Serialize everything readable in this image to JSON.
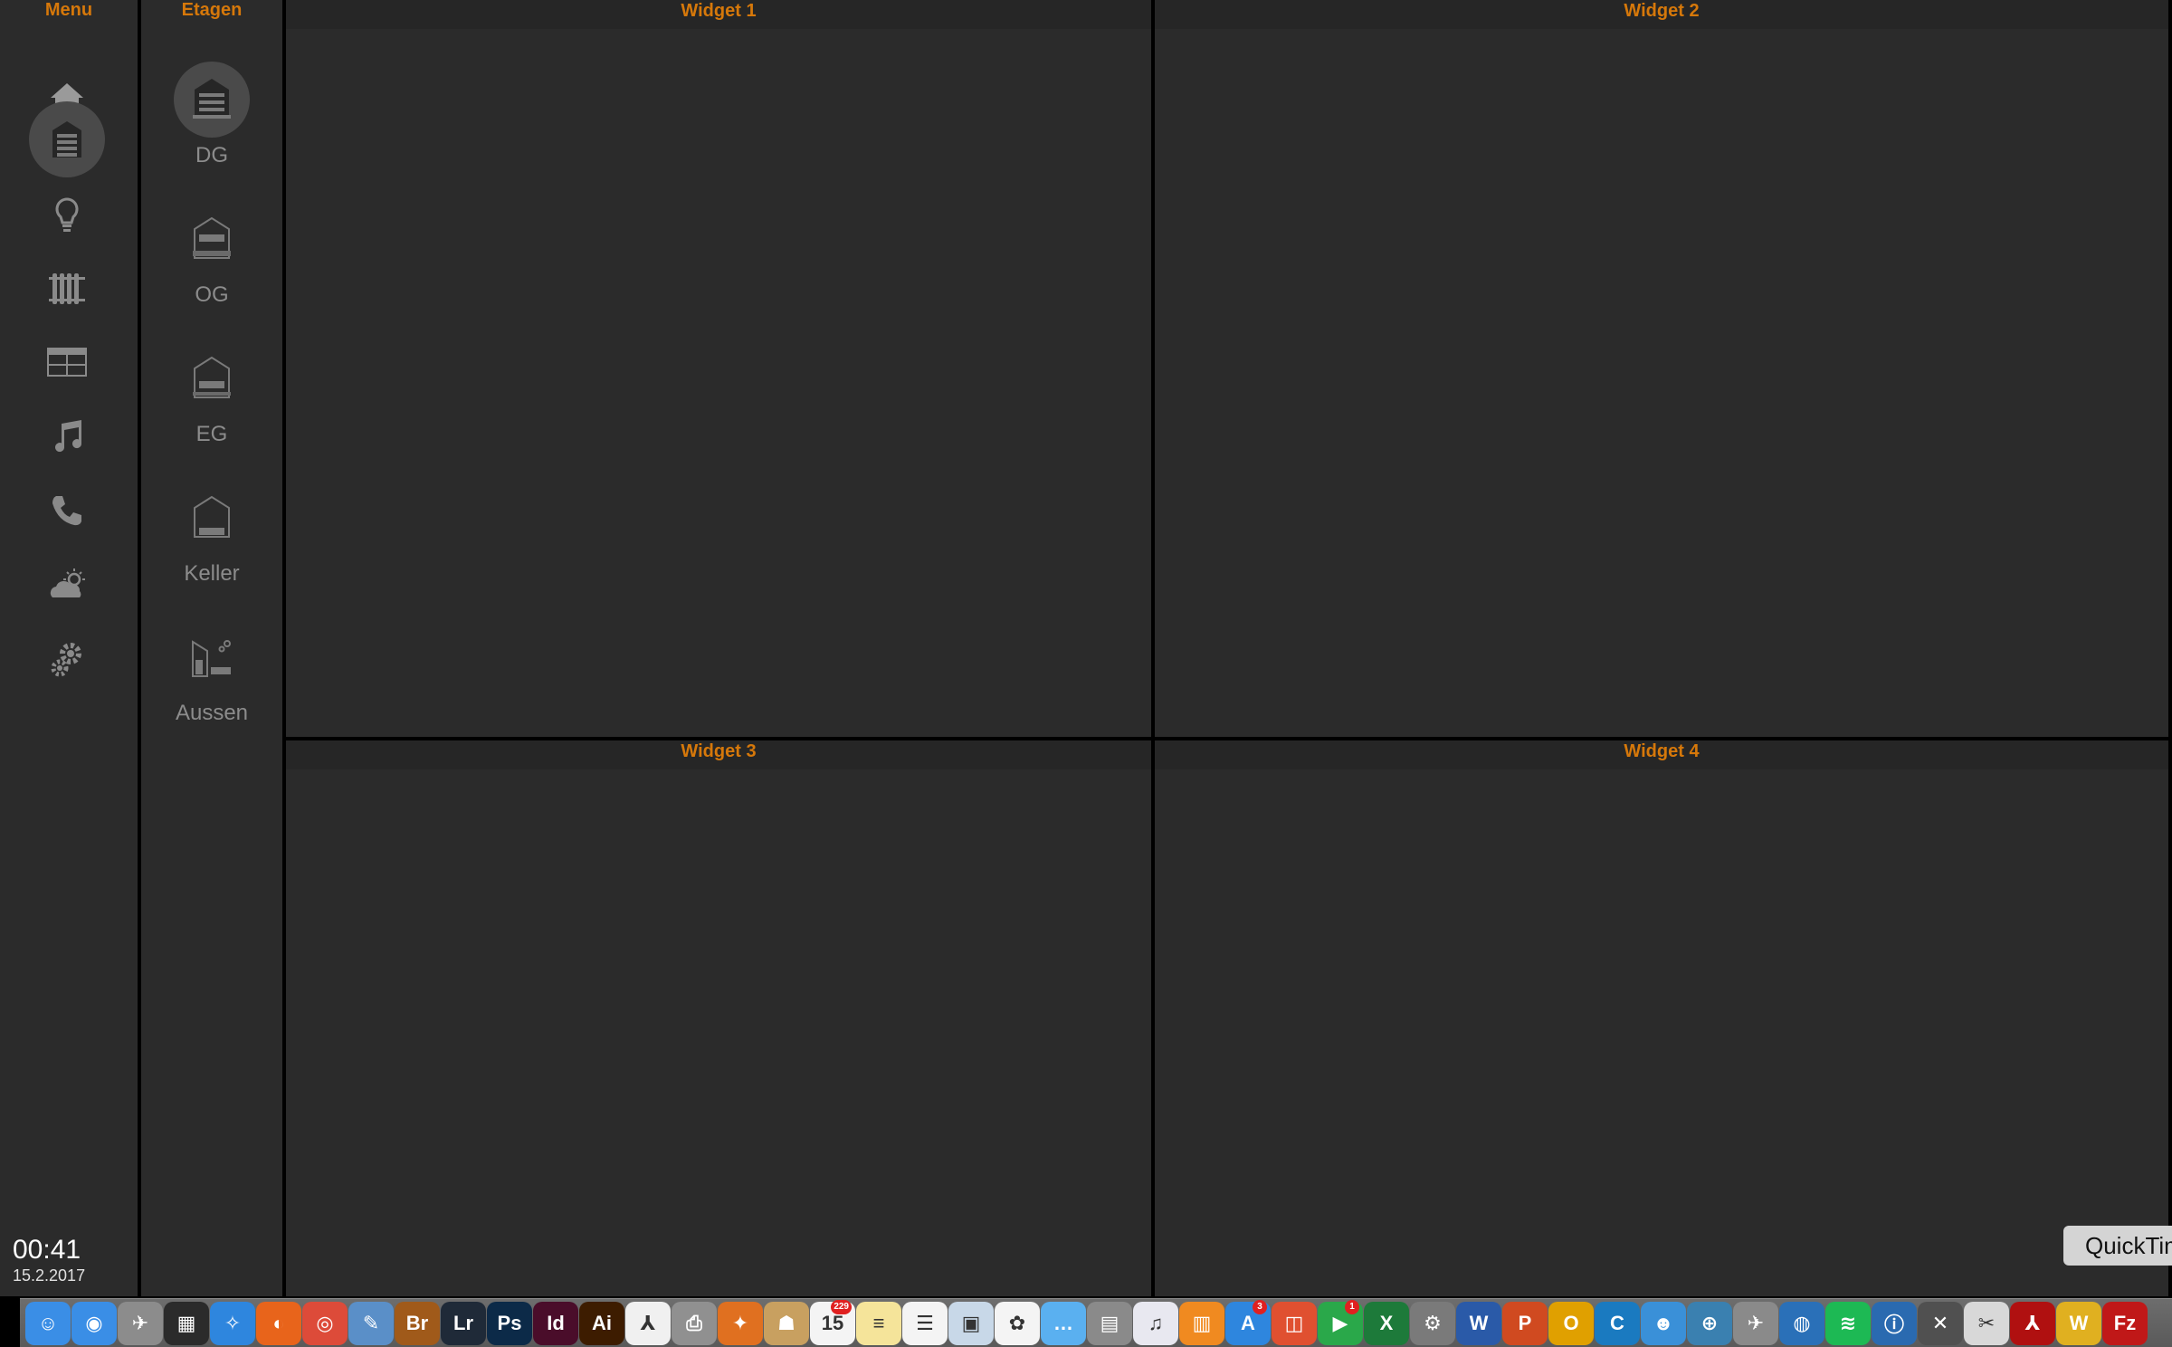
{
  "menu": {
    "header": "Menu",
    "items": [
      {
        "icon": "home-icon"
      },
      {
        "icon": "building-icon",
        "active": true
      },
      {
        "icon": "lightbulb-icon"
      },
      {
        "icon": "radiator-icon"
      },
      {
        "icon": "blinds-icon"
      },
      {
        "icon": "music-note-icon"
      },
      {
        "icon": "phone-icon"
      },
      {
        "icon": "weather-icon"
      },
      {
        "icon": "gears-icon"
      }
    ]
  },
  "etagen": {
    "header": "Etagen",
    "floors": [
      {
        "label": "DG",
        "icon": "house-attic-icon",
        "active": true
      },
      {
        "label": "OG",
        "icon": "house-upper-floor-icon"
      },
      {
        "label": "EG",
        "icon": "house-ground-floor-icon"
      },
      {
        "label": "Keller",
        "icon": "house-basement-icon"
      },
      {
        "label": "Aussen",
        "icon": "outdoor-icon"
      }
    ]
  },
  "widgets": [
    {
      "title": "Widget 1"
    },
    {
      "title": "Widget 2"
    },
    {
      "title": "Widget 3"
    },
    {
      "title": "Widget 4"
    }
  ],
  "clock": {
    "time": "00:41",
    "date": "15.2.2017"
  },
  "tooltip": {
    "text": "QuickTime"
  },
  "dock": {
    "apps": [
      {
        "name": "finder-icon",
        "color": "#3a8ee6",
        "glyph": "☺"
      },
      {
        "name": "migration-icon",
        "color": "#3a8ee6",
        "glyph": "◉"
      },
      {
        "name": "launchpad-icon",
        "color": "#8c8c8c",
        "glyph": "✈"
      },
      {
        "name": "mission-control-icon",
        "color": "#2b2b2b",
        "glyph": "▦"
      },
      {
        "name": "safari-icon",
        "color": "#2e86de",
        "glyph": "✧"
      },
      {
        "name": "firefox-icon",
        "color": "#e8641b",
        "glyph": "◐"
      },
      {
        "name": "chrome-icon",
        "color": "#dd4b39",
        "glyph": "◎"
      },
      {
        "name": "preview-icon",
        "color": "#5a8fc8",
        "glyph": "✎"
      },
      {
        "name": "bridge-icon",
        "color": "#a05a1a",
        "glyph": "Br"
      },
      {
        "name": "lightroom-icon",
        "color": "#1f2a38",
        "glyph": "Lr"
      },
      {
        "name": "photoshop-icon",
        "color": "#0c2a48",
        "glyph": "Ps"
      },
      {
        "name": "indesign-icon",
        "color": "#4a0d2a",
        "glyph": "Id"
      },
      {
        "name": "illustrator-icon",
        "color": "#3d1c00",
        "glyph": "Ai"
      },
      {
        "name": "acrobat-icon",
        "color": "#f0f0f0",
        "glyph": "⅄"
      },
      {
        "name": "printer-icon",
        "color": "#909090",
        "glyph": "⎙"
      },
      {
        "name": "keynote-icon",
        "color": "#e07020",
        "glyph": "✦"
      },
      {
        "name": "contacts-icon",
        "color": "#c8a060",
        "glyph": "☗"
      },
      {
        "name": "calendar-icon",
        "color": "#f4f4f4",
        "glyph": "15",
        "badge": "229"
      },
      {
        "name": "notes-icon",
        "color": "#f5e49a",
        "glyph": "≡"
      },
      {
        "name": "reminders-icon",
        "color": "#f4f4f4",
        "glyph": "☰"
      },
      {
        "name": "image-capture-icon",
        "color": "#c8d8e8",
        "glyph": "▣"
      },
      {
        "name": "photos-icon",
        "color": "#f4f4f4",
        "glyph": "✿"
      },
      {
        "name": "messages-icon",
        "color": "#5ab0f0",
        "glyph": "…"
      },
      {
        "name": "calculator-icon",
        "color": "#8a8a8a",
        "glyph": "▤"
      },
      {
        "name": "itunes-icon",
        "color": "#e8e8f0",
        "glyph": "♫"
      },
      {
        "name": "ibooks-icon",
        "color": "#f08a20",
        "glyph": "▥"
      },
      {
        "name": "app-store-icon",
        "color": "#2e86de",
        "glyph": "A",
        "badge": "3"
      },
      {
        "name": "screen-sharing-icon",
        "color": "#e05030",
        "glyph": "◫"
      },
      {
        "name": "facetime-icon",
        "color": "#2aa84a",
        "glyph": "▶",
        "badge": "1"
      },
      {
        "name": "excel-icon",
        "color": "#1d7a3a",
        "glyph": "X"
      },
      {
        "name": "system-preferences-icon",
        "color": "#7a7a7a",
        "glyph": "⚙"
      },
      {
        "name": "word-icon",
        "color": "#2a5aa8",
        "glyph": "W"
      },
      {
        "name": "powerpoint-icon",
        "color": "#d04a20",
        "glyph": "P"
      },
      {
        "name": "outlook-icon",
        "color": "#e0a000",
        "glyph": "O"
      },
      {
        "name": "cyberduck-icon",
        "color": "#1a7ac0",
        "glyph": "C"
      },
      {
        "name": "lync-icon",
        "color": "#3a90d8",
        "glyph": "☻"
      },
      {
        "name": "network-icon",
        "color": "#3a80b0",
        "glyph": "⊕"
      },
      {
        "name": "wireless-diagnostics-icon",
        "color": "#8a8a8a",
        "glyph": "✈"
      },
      {
        "name": "web-globe-icon",
        "color": "#2a70b8",
        "glyph": "◍"
      },
      {
        "name": "spotify-icon",
        "color": "#1db954",
        "glyph": "≋"
      },
      {
        "name": "1password-icon",
        "color": "#2a6ab0",
        "glyph": "ⓘ"
      },
      {
        "name": "x11-icon",
        "color": "#505050",
        "glyph": "✕"
      },
      {
        "name": "archive-utility-icon",
        "color": "#d8d8d8",
        "glyph": "✂"
      },
      {
        "name": "acrobat-pro-icon",
        "color": "#b01010",
        "glyph": "⅄"
      },
      {
        "name": "winzip-icon",
        "color": "#e0b020",
        "glyph": "W"
      },
      {
        "name": "filezilla-icon",
        "color": "#c01818",
        "glyph": "Fz"
      }
    ]
  }
}
